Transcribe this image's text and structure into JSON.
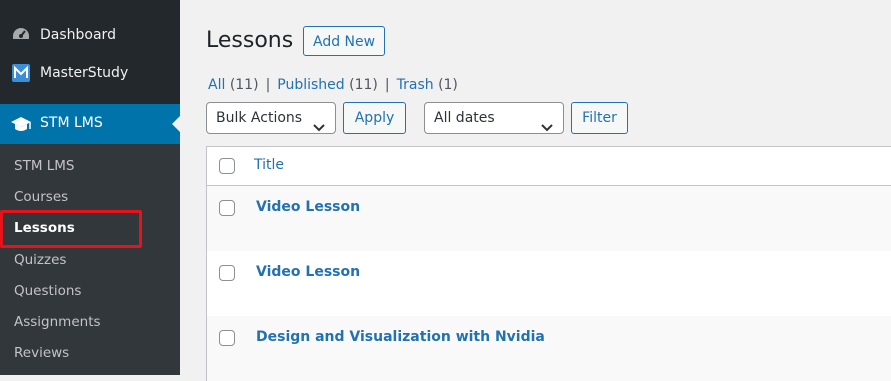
{
  "sidebar": {
    "top_items": [
      {
        "label": "Dashboard",
        "icon": "dashboard-icon"
      },
      {
        "label": "MasterStudy",
        "icon": "masterstudy-logo-icon"
      }
    ],
    "current_menu": {
      "label": "STM LMS",
      "icon": "graduation-cap-icon"
    },
    "submenu": [
      {
        "label": "STM LMS"
      },
      {
        "label": "Courses"
      },
      {
        "label": "Lessons",
        "active": true
      },
      {
        "label": "Quizzes"
      },
      {
        "label": "Questions"
      },
      {
        "label": "Assignments"
      },
      {
        "label": "Reviews"
      }
    ],
    "highlight_color": "#e8121b"
  },
  "header": {
    "title": "Lessons",
    "add_new_label": "Add New"
  },
  "filters": {
    "views": [
      {
        "label": "All",
        "count": "(11)"
      },
      {
        "label": "Published",
        "count": "(11)"
      },
      {
        "label": "Trash",
        "count": "(1)"
      }
    ],
    "separator": "|",
    "bulk_actions": {
      "selected": "Bulk Actions"
    },
    "apply_label": "Apply",
    "dates": {
      "selected": "All dates"
    },
    "filter_label": "Filter"
  },
  "table": {
    "columns": [
      "Title"
    ],
    "rows": [
      {
        "title": "Video Lesson"
      },
      {
        "title": "Video Lesson"
      },
      {
        "title": "Design and Visualization with Nvidia"
      }
    ]
  },
  "colors": {
    "sidebar_bg": "#23282d",
    "submenu_bg": "#32373c",
    "accent": "#0073aa",
    "link": "#2271b1"
  }
}
